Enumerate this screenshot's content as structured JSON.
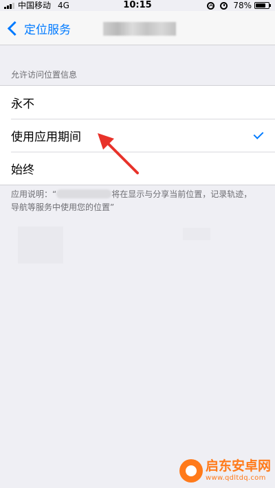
{
  "status_bar": {
    "carrier": "中国移动",
    "network": "4G",
    "time": "10:15",
    "battery_percent": "78%",
    "battery_level": 0.78
  },
  "nav": {
    "back_label": "定位服务"
  },
  "section": {
    "header": "允许访问位置信息"
  },
  "options": [
    {
      "label": "永不",
      "selected": false
    },
    {
      "label": "使用应用期间",
      "selected": true
    },
    {
      "label": "始终",
      "selected": false
    }
  ],
  "footer": {
    "prefix": "应用说明：“",
    "suffix": "将在显示与分享当前位置，记录轨迹，导航等服务中使用您的位置”"
  },
  "watermark": {
    "name": "启东安卓网",
    "url": "www.qdltdq.com"
  },
  "colors": {
    "accent": "#007aff",
    "background": "#efeff4",
    "annotation": "#e8322a",
    "watermark": "#ff7a1a"
  }
}
